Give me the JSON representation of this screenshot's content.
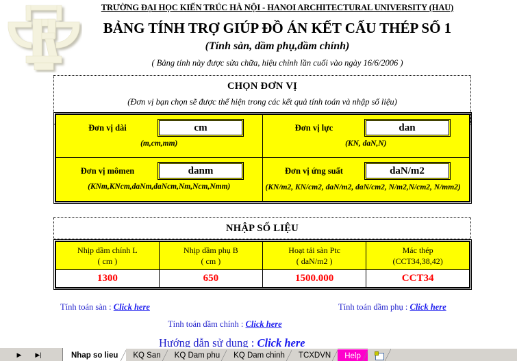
{
  "header": {
    "university": "TRƯỜNG ĐẠI HỌC KIẾN TRÚC HÀ NỘI - HANOI ARCHITECTURAL UNIVERSITY (HAU)",
    "title": "BẢNG TÍNH TRỢ GIÚP ĐỒ ÁN KẾT CẤU THÉP SỐ 1",
    "subtitle": "(Tính sàn, dầm phụ,dầm chính)",
    "note": "( Bảng tính này được sửa chữa, hiệu chỉnh lần cuối vào ngày 16/6/2006 )",
    "logo_name": "hau-university-logo"
  },
  "units": {
    "panel_title": "CHỌN ĐƠN VỊ",
    "panel_subtitle": "(Đơn vị bạn chọn sẽ được thể hiện trong các kết quả tính toán và nhập số liệu)",
    "fields": [
      {
        "label": "Đơn vị dài",
        "value": "cm",
        "hint": "(m,cm,mm)"
      },
      {
        "label": "Đơn vị lực",
        "value": "dan",
        "hint": "(KN, daN,N)"
      },
      {
        "label": "Đơn vị mômen",
        "value": "danm",
        "hint": "(KNm,KNcm,daNm,daNcm,Nm,Ncm,Nmm)"
      },
      {
        "label": "Đơn vị ứng suất",
        "value": "daN/m2",
        "hint": "(KN/m2, KN/cm2, daN/m2, daN/cm2, N/m2,N/cm2, N/mm2)"
      }
    ]
  },
  "data_input": {
    "panel_title": "NHẬP SỐ LIỆU",
    "columns": [
      {
        "line1": "Nhịp dầm chính L",
        "line2": "( cm )",
        "value": "1300"
      },
      {
        "line1": "Nhịp dầm phụ B",
        "line2": "( cm )",
        "value": "650"
      },
      {
        "line1": "Hoạt tải sàn Ptc",
        "line2": "( daN/m2  )",
        "value": "1500.000"
      },
      {
        "line1": "Mác thép",
        "line2": "(CCT34,38,42)",
        "value": "CCT34"
      }
    ]
  },
  "links": {
    "slab": {
      "label": "Tính toán sàn : ",
      "action": "Click here"
    },
    "secondary_beam": {
      "label": "Tính toán dầm phụ : ",
      "action": "Click here"
    },
    "main_beam": {
      "label": "Tính toán dầm chính : ",
      "action": "Click here"
    },
    "guide": {
      "label": "Hướng dẫn sử dụng : ",
      "action": "Click here"
    }
  },
  "tabbar": {
    "nav": {
      "next": "▶",
      "last": "▶|"
    },
    "tabs": [
      {
        "label": "Nhap so lieu",
        "state": "active"
      },
      {
        "label": "KQ San",
        "state": "normal"
      },
      {
        "label": "KQ Dam phu",
        "state": "normal"
      },
      {
        "label": "KQ Dam chinh",
        "state": "normal"
      },
      {
        "label": "TCXDVN",
        "state": "normal"
      },
      {
        "label": "Help",
        "state": "help"
      }
    ]
  },
  "colors": {
    "cell_fill": "#ffff00",
    "value_text": "#ff0000",
    "link_text": "#2222cc",
    "help_tab": "#ff00cc",
    "logo": "#f2f0dc"
  }
}
